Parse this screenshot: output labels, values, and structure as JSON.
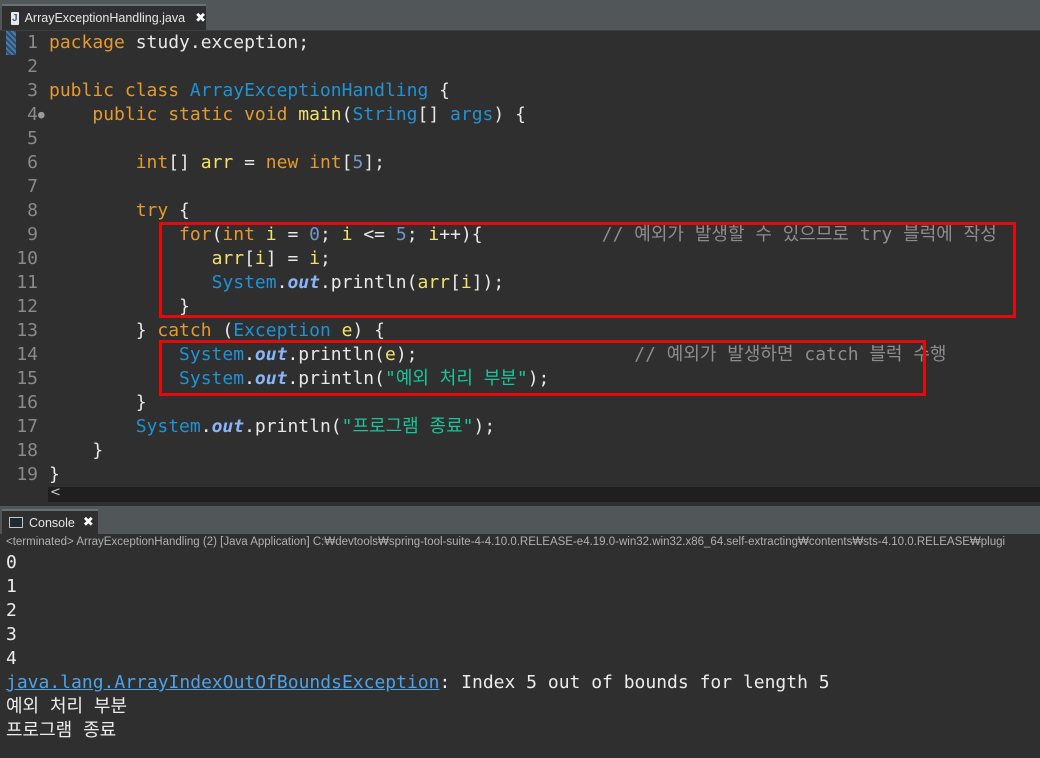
{
  "editor_tab": {
    "title": "ArrayExceptionHandling.java",
    "icon": "J"
  },
  "code": {
    "lines": [
      {
        "n": "1",
        "t": [
          [
            "kw",
            "package"
          ],
          [
            "p",
            " study.exception;"
          ]
        ]
      },
      {
        "n": "2",
        "t": []
      },
      {
        "n": "3",
        "t": [
          [
            "kw",
            "public class"
          ],
          [
            "p",
            " "
          ],
          [
            "cls",
            "ArrayExceptionHandling"
          ],
          [
            "p",
            " {"
          ]
        ]
      },
      {
        "n": "4",
        "t": [
          [
            "p",
            "    "
          ],
          [
            "kw",
            "public static void"
          ],
          [
            "p",
            " "
          ],
          [
            "var",
            "main"
          ],
          [
            "p",
            "("
          ],
          [
            "cls",
            "String"
          ],
          [
            "p",
            "[] "
          ],
          [
            "cls",
            "args"
          ],
          [
            "p",
            ") {"
          ]
        ]
      },
      {
        "n": "5",
        "t": []
      },
      {
        "n": "6",
        "t": [
          [
            "p",
            "        "
          ],
          [
            "kw",
            "int"
          ],
          [
            "p",
            "[] "
          ],
          [
            "var",
            "arr"
          ],
          [
            "p",
            " = "
          ],
          [
            "kw",
            "new int"
          ],
          [
            "p",
            "["
          ],
          [
            "num",
            "5"
          ],
          [
            "p",
            "];"
          ]
        ]
      },
      {
        "n": "7",
        "t": []
      },
      {
        "n": "8",
        "t": [
          [
            "p",
            "        "
          ],
          [
            "kw",
            "try"
          ],
          [
            "p",
            " {"
          ]
        ]
      },
      {
        "n": "9",
        "t": [
          [
            "p",
            "            "
          ],
          [
            "kw",
            "for"
          ],
          [
            "p",
            "("
          ],
          [
            "kw",
            "int"
          ],
          [
            "p",
            " "
          ],
          [
            "var",
            "i"
          ],
          [
            "p",
            " = "
          ],
          [
            "num",
            "0"
          ],
          [
            "p",
            "; "
          ],
          [
            "var",
            "i"
          ],
          [
            "p",
            " <= "
          ],
          [
            "num",
            "5"
          ],
          [
            "p",
            "; "
          ],
          [
            "var",
            "i"
          ],
          [
            "p",
            "++){           "
          ],
          [
            "cm",
            "// 예외가 발생할 수 있으므로 try 블럭에 작성"
          ]
        ]
      },
      {
        "n": "10",
        "t": [
          [
            "p",
            "               "
          ],
          [
            "var",
            "arr"
          ],
          [
            "p",
            "["
          ],
          [
            "var",
            "i"
          ],
          [
            "p",
            "] = "
          ],
          [
            "var",
            "i"
          ],
          [
            "p",
            ";"
          ]
        ]
      },
      {
        "n": "11",
        "t": [
          [
            "p",
            "               "
          ],
          [
            "cls",
            "System"
          ],
          [
            "p",
            "."
          ],
          [
            "fld",
            "out"
          ],
          [
            "p",
            ".println("
          ],
          [
            "var",
            "arr"
          ],
          [
            "p",
            "["
          ],
          [
            "var",
            "i"
          ],
          [
            "p",
            "]);"
          ]
        ]
      },
      {
        "n": "12",
        "t": [
          [
            "p",
            "            }"
          ]
        ]
      },
      {
        "n": "13",
        "t": [
          [
            "p",
            "        } "
          ],
          [
            "kw",
            "catch"
          ],
          [
            "p",
            " ("
          ],
          [
            "cls",
            "Exception"
          ],
          [
            "p",
            " "
          ],
          [
            "var",
            "e"
          ],
          [
            "p",
            ") {"
          ]
        ]
      },
      {
        "n": "14",
        "t": [
          [
            "p",
            "            "
          ],
          [
            "cls",
            "System"
          ],
          [
            "p",
            "."
          ],
          [
            "fld",
            "out"
          ],
          [
            "p",
            ".println("
          ],
          [
            "var",
            "e"
          ],
          [
            "p",
            ");                    "
          ],
          [
            "cm",
            "// 예외가 발생하면 catch 블럭 수행"
          ]
        ]
      },
      {
        "n": "15",
        "t": [
          [
            "p",
            "            "
          ],
          [
            "cls",
            "System"
          ],
          [
            "p",
            "."
          ],
          [
            "fld",
            "out"
          ],
          [
            "p",
            ".println("
          ],
          [
            "str",
            "\"예외 처리 부분\""
          ],
          [
            "p",
            ");"
          ]
        ]
      },
      {
        "n": "16",
        "t": [
          [
            "p",
            "        }"
          ]
        ]
      },
      {
        "n": "17",
        "t": [
          [
            "p",
            "        "
          ],
          [
            "cls",
            "System"
          ],
          [
            "p",
            "."
          ],
          [
            "fld",
            "out"
          ],
          [
            "p",
            ".println("
          ],
          [
            "str",
            "\"프로그램 종료\""
          ],
          [
            "p",
            ");"
          ]
        ]
      },
      {
        "n": "18",
        "t": [
          [
            "p",
            "    }"
          ]
        ]
      },
      {
        "n": "19",
        "t": [
          [
            "p",
            "}"
          ]
        ]
      }
    ]
  },
  "scroll_arrow": "<",
  "console_tab": {
    "title": "Console"
  },
  "console": {
    "status": "<terminated> ArrayExceptionHandling (2) [Java Application] C:₩devtools₩spring-tool-suite-4-4.10.0.RELEASE-e4.19.0-win32.win32.x86_64.self-extracting₩contents₩sts-4.10.0.RELEASE₩plugi",
    "lines": [
      "0",
      "1",
      "2",
      "3",
      "4"
    ],
    "exception_class": "java.lang.ArrayIndexOutOfBoundsException",
    "exception_message": ": Index 5 out of bounds for length 5",
    "after_lines": [
      "예외 처리 부분",
      "프로그램 종료"
    ]
  },
  "colors": {
    "keyword": "#e69a2d",
    "class": "#1e93d6",
    "string": "#19c59a",
    "comment": "#8d8d8d",
    "highlight_box": "#e20a0a",
    "background": "#2f2f2f"
  }
}
